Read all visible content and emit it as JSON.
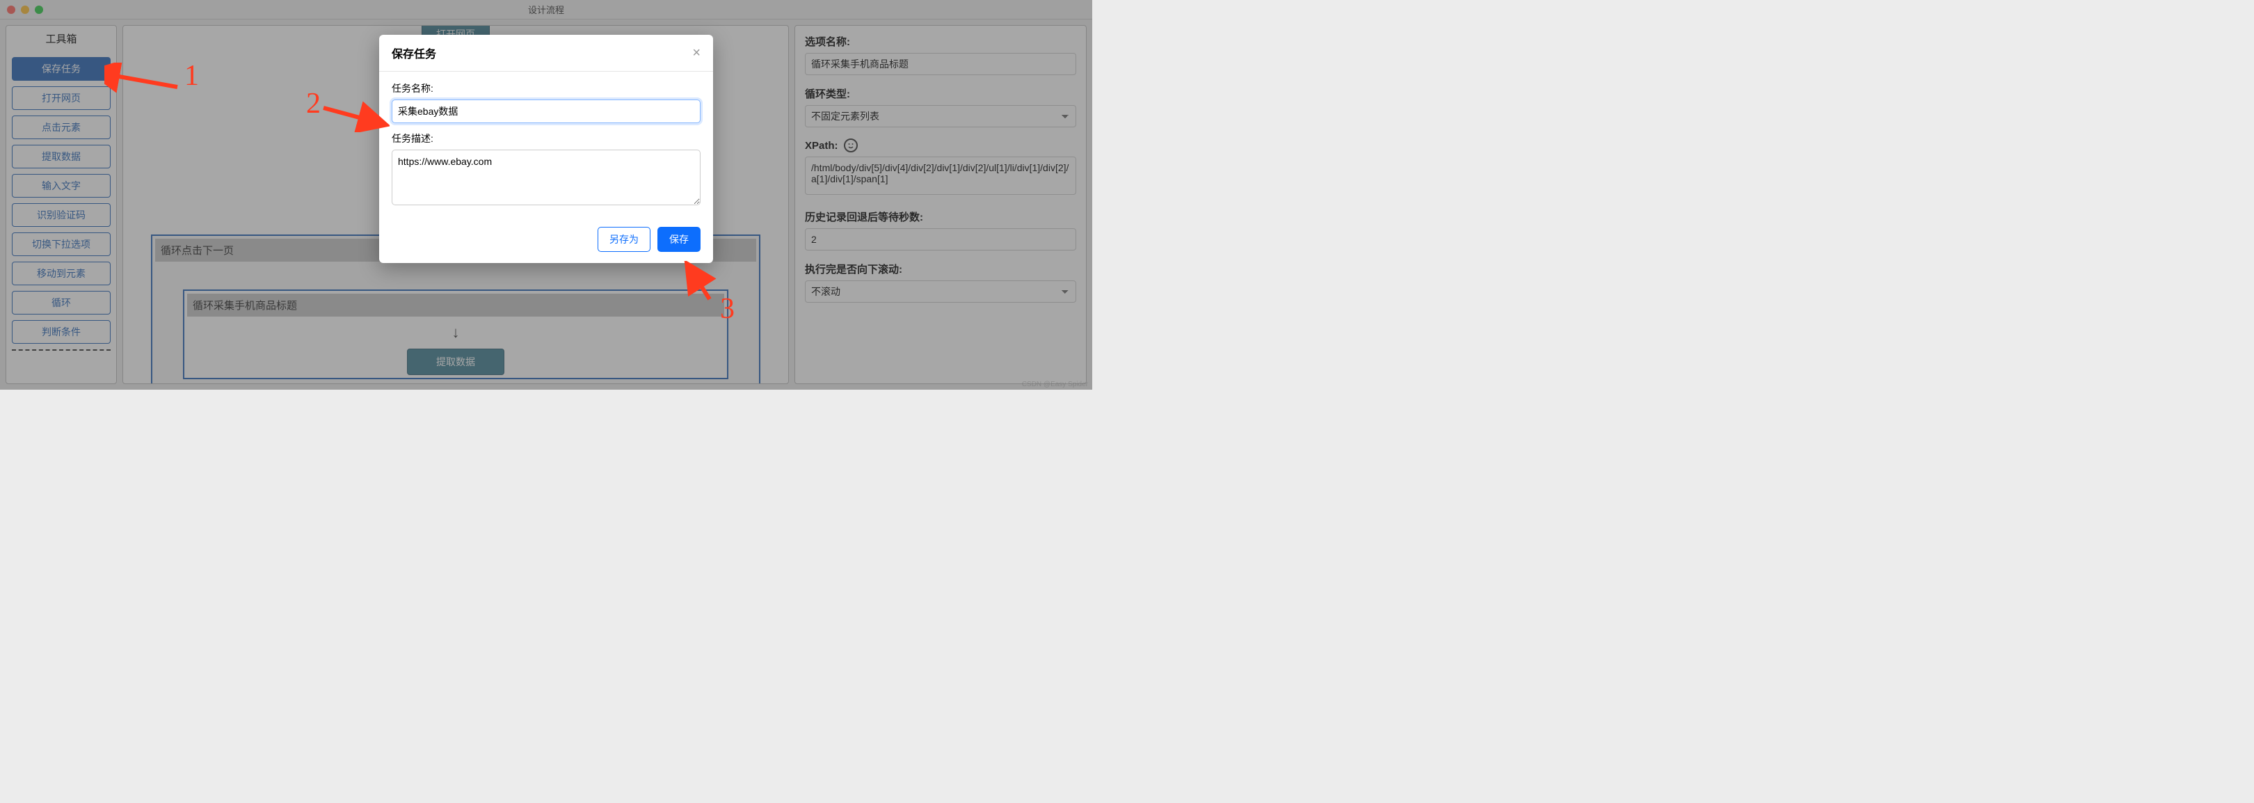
{
  "window": {
    "title": "设计流程"
  },
  "toolbox": {
    "title": "工具箱",
    "buttons": [
      {
        "label": "保存任务",
        "primary": true
      },
      {
        "label": "打开网页"
      },
      {
        "label": "点击元素"
      },
      {
        "label": "提取数据"
      },
      {
        "label": "输入文字"
      },
      {
        "label": "识别验证码"
      },
      {
        "label": "切换下拉选项"
      },
      {
        "label": "移动到元素"
      },
      {
        "label": "循环"
      },
      {
        "label": "判断条件"
      }
    ]
  },
  "canvas": {
    "top_node": "打开网页",
    "outer_loop_title": "循环点击下一页",
    "inner_loop_title": "循环采集手机商品标题",
    "arrow": "↓",
    "extract_node": "提取数据"
  },
  "modal": {
    "title": "保存任务",
    "close": "×",
    "name_label": "任务名称:",
    "name_value": "采集ebay数据",
    "desc_label": "任务描述:",
    "desc_value": "https://www.ebay.com",
    "save_as": "另存为",
    "save": "保存"
  },
  "props": {
    "option_name_label": "选项名称:",
    "option_name_value": "循环采集手机商品标题",
    "loop_type_label": "循环类型:",
    "loop_type_value": "不固定元素列表",
    "xpath_label": "XPath:",
    "xpath_value": "/html/body/div[5]/div[4]/div[2]/div[1]/div[2]/ul[1]/li/div[1]/div[2]/a[1]/div[1]/span[1]",
    "history_label": "历史记录回退后等待秒数:",
    "history_value": "2",
    "scroll_label": "执行完是否向下滚动:",
    "scroll_value": "不滚动"
  },
  "annotations": {
    "one": "1",
    "two": "2",
    "three": "3"
  },
  "watermark": "CSDN @Easy Spider"
}
